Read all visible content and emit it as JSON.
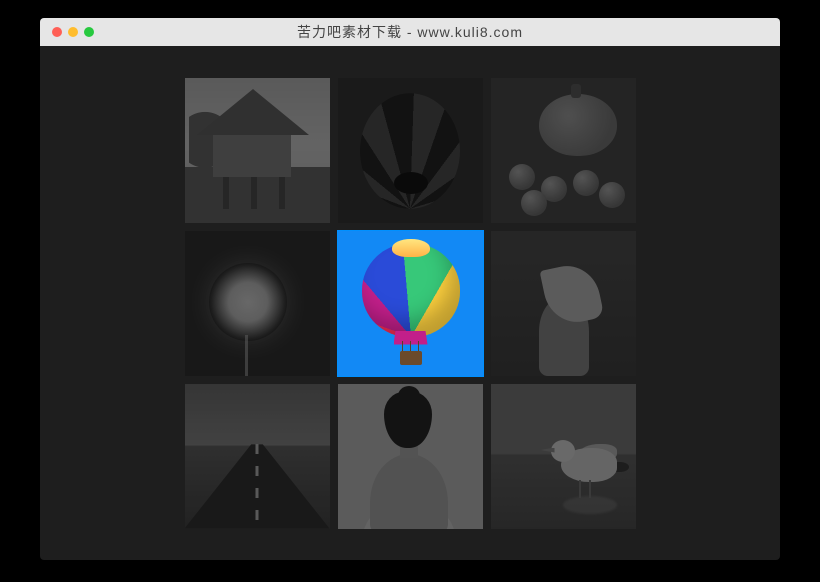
{
  "window": {
    "title": "苦力吧素材下载 - www.kuli8.com"
  },
  "gallery": {
    "active_index": 4,
    "tiles": [
      {
        "name": "thatched-hut"
      },
      {
        "name": "balloon-underside"
      },
      {
        "name": "pumpkin-apples"
      },
      {
        "name": "dandelion"
      },
      {
        "name": "rainbow-balloon"
      },
      {
        "name": "hand-leaf"
      },
      {
        "name": "road-horizon"
      },
      {
        "name": "woman-back"
      },
      {
        "name": "seagull-beach"
      }
    ]
  }
}
